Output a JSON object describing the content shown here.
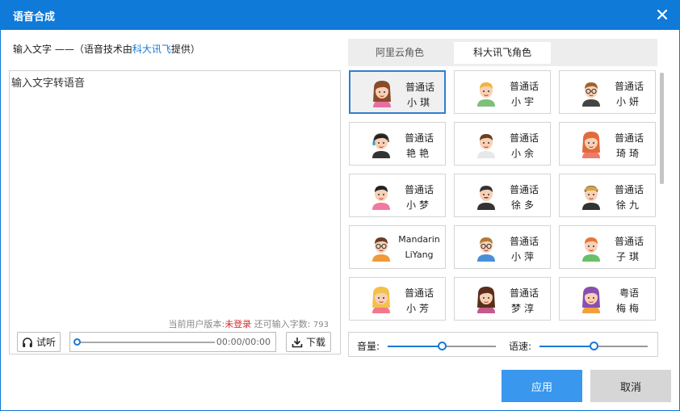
{
  "window": {
    "title": "语音合成",
    "close_icon": "close-icon"
  },
  "input_section": {
    "label_prefix": "输入文字 ——（语音技术由",
    "label_brand": "科大讯飞",
    "label_suffix": "提供）",
    "placeholder": "输入文字转语音",
    "value": ""
  },
  "status": {
    "version_label": "当前用户版本:",
    "version_value": "未登录",
    "remaining_label": "还可输入字数:",
    "remaining_count": "793"
  },
  "player": {
    "listen_label": "试听",
    "listen_icon": "headphones-icon",
    "progress": 0,
    "time": "00:00/00:00",
    "download_label": "下载",
    "download_icon": "download-icon"
  },
  "tabs": [
    {
      "label": "阿里云角色",
      "active": false
    },
    {
      "label": "科大讯飞角色",
      "active": true
    }
  ],
  "voices": [
    {
      "lang": "普通话",
      "name": "小琪",
      "avatar": "girl-avatar-icon",
      "selected": true
    },
    {
      "lang": "普通话",
      "name": "小宇",
      "avatar": "boy-avatar-icon",
      "selected": false
    },
    {
      "lang": "普通话",
      "name": "小妍",
      "avatar": "woman-glasses-avatar-icon",
      "selected": false
    },
    {
      "lang": "普通话",
      "name": "艳艳",
      "avatar": "woman-headset-avatar-icon",
      "selected": false
    },
    {
      "lang": "普通话",
      "name": "小余",
      "avatar": "man-avatar-icon",
      "selected": false
    },
    {
      "lang": "普通话",
      "name": "琦琦",
      "avatar": "redhair-girl-avatar-icon",
      "selected": false
    },
    {
      "lang": "普通话",
      "name": "小梦",
      "avatar": "boy-pink-avatar-icon",
      "selected": false
    },
    {
      "lang": "普通话",
      "name": "徐多",
      "avatar": "man-mustache-avatar-icon",
      "selected": false
    },
    {
      "lang": "普通话",
      "name": "徐九",
      "avatar": "man-cap-avatar-icon",
      "selected": false
    },
    {
      "lang": "Mandarin",
      "name": "LiYang",
      "avatar": "boy-glasses-avatar-icon",
      "selected": false
    },
    {
      "lang": "普通话",
      "name": "小萍",
      "avatar": "girl-glasses-avatar-icon",
      "selected": false
    },
    {
      "lang": "普通话",
      "name": "子琪",
      "avatar": "orangehair-boy-avatar-icon",
      "selected": false
    },
    {
      "lang": "普通话",
      "name": "小芳",
      "avatar": "blonde-girl-avatar-icon",
      "selected": false
    },
    {
      "lang": "普通话",
      "name": "梦淳",
      "avatar": "longhair-woman-avatar-icon",
      "selected": false
    },
    {
      "lang": "粤语",
      "name": "梅梅",
      "avatar": "purplehair-woman-avatar-icon",
      "selected": false
    }
  ],
  "controls": {
    "volume_label": "音量:",
    "volume_level": 0.5,
    "speed_label": "语速:",
    "speed_level": 0.5
  },
  "actions": {
    "apply_label": "应用",
    "cancel_label": "取消"
  },
  "colors": {
    "titlebar": "#0f7ad8",
    "accent": "#1a7ad6",
    "apply": "#3a97ee",
    "warning": "#d12b2b"
  }
}
